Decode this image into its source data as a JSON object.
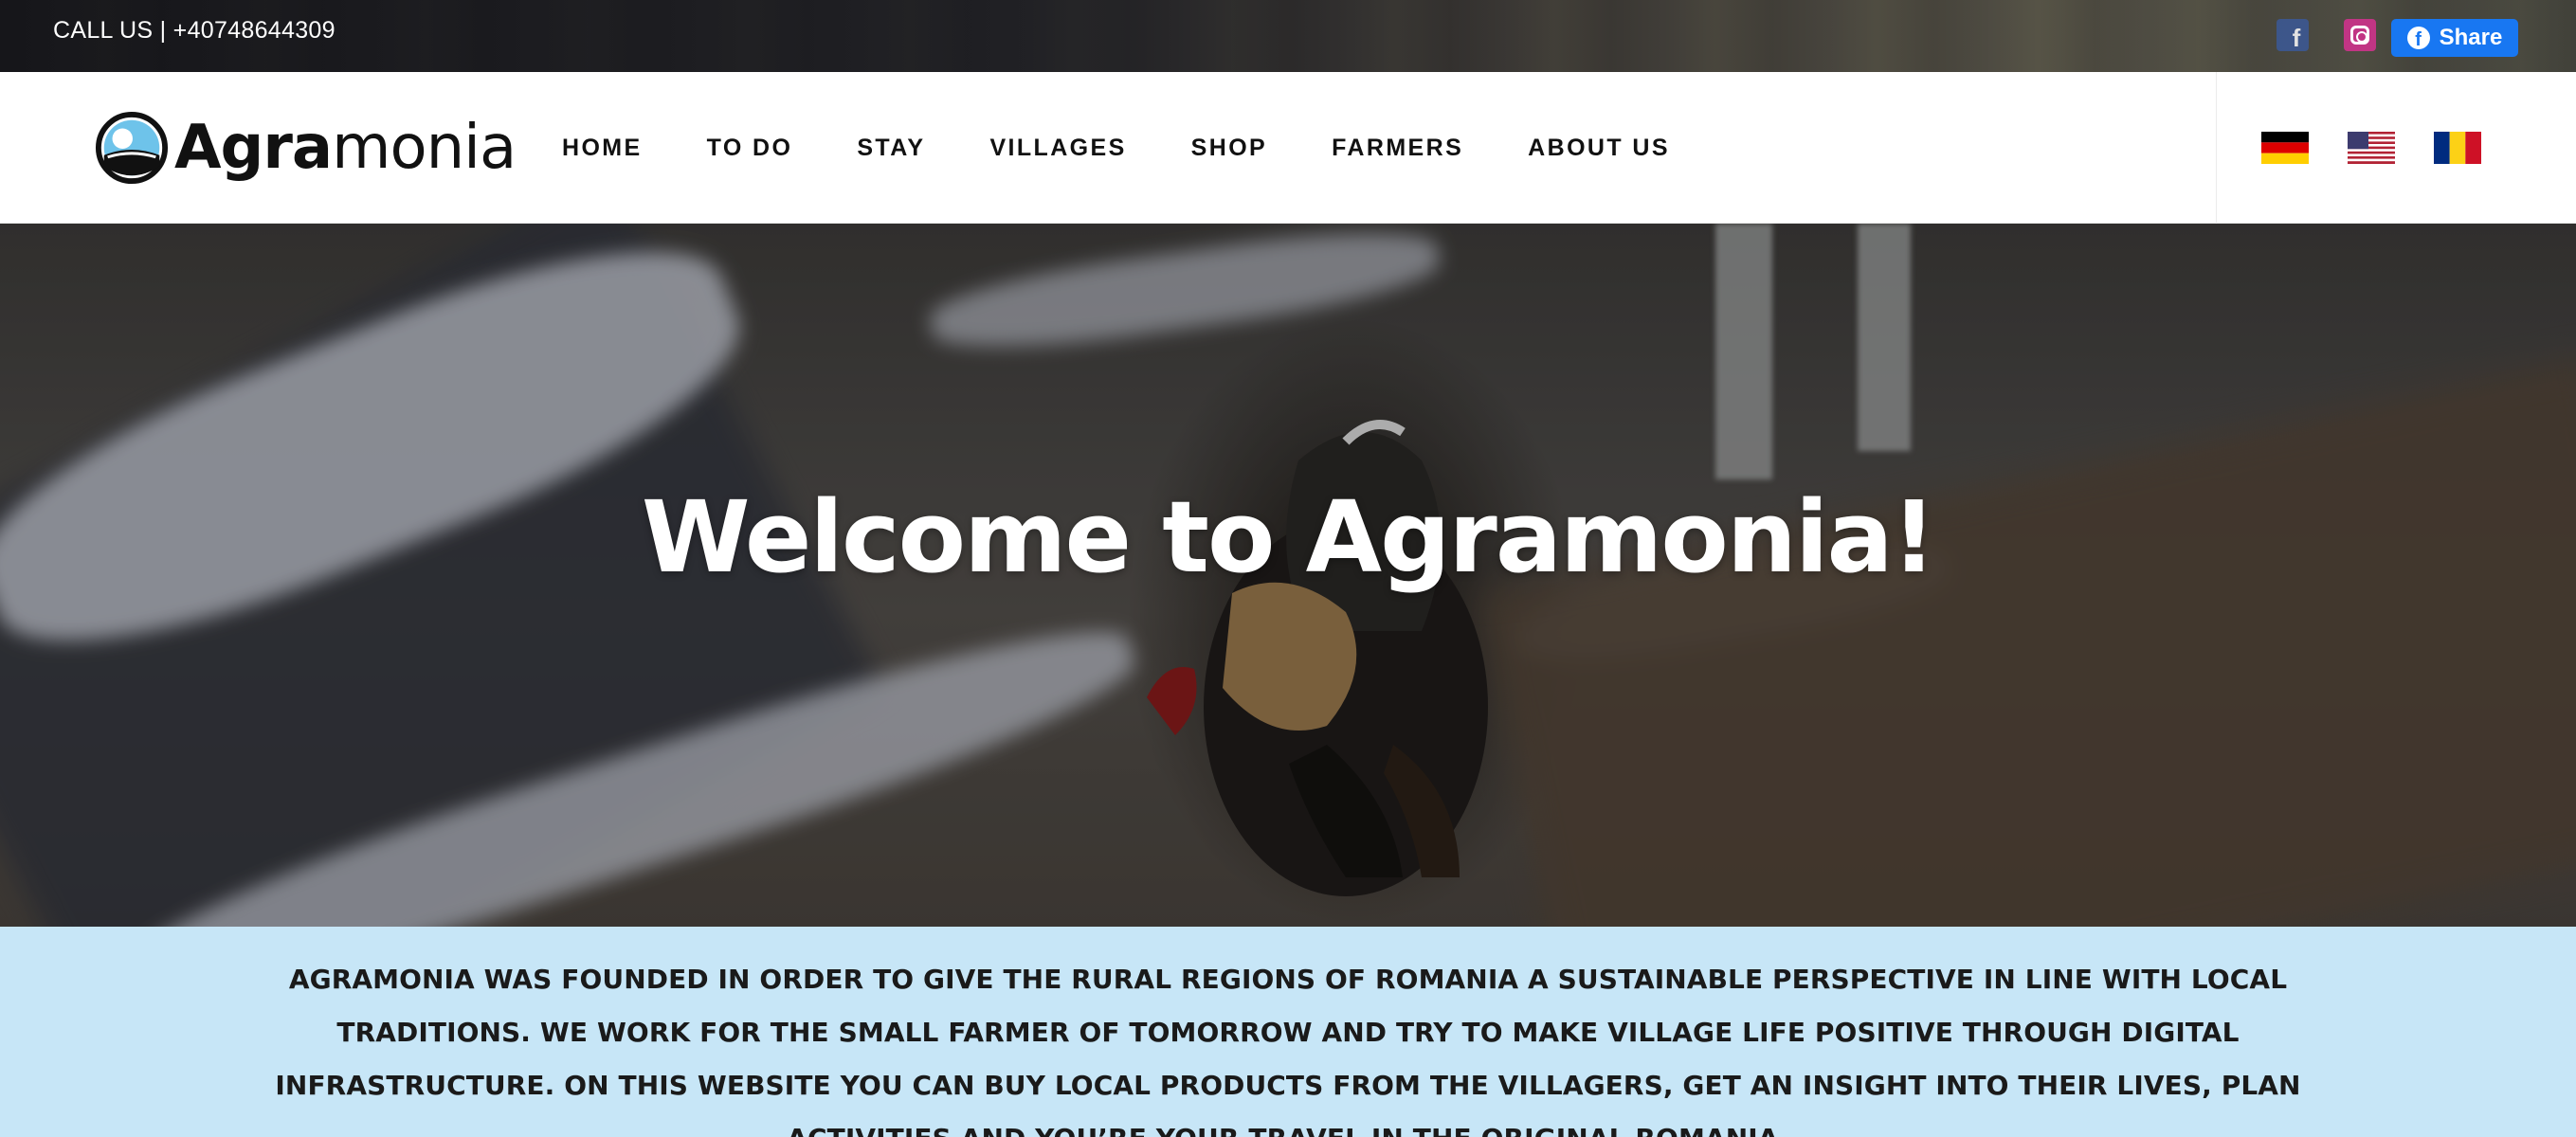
{
  "topbar": {
    "call_text": "CALL US | +40748644309",
    "social": [
      {
        "icon": "facebook-icon",
        "color": "#3b5998"
      },
      {
        "icon": "instagram-icon",
        "color": "#c13584"
      }
    ],
    "share_label": "Share",
    "share_color": "#1877f2"
  },
  "logo": {
    "bold": "Agra",
    "light": "monia"
  },
  "nav": {
    "items": [
      {
        "label": "HOME"
      },
      {
        "label": "TO DO"
      },
      {
        "label": "STAY"
      },
      {
        "label": "VILLAGES"
      },
      {
        "label": "SHOP"
      },
      {
        "label": "FARMERS"
      },
      {
        "label": "ABOUT US"
      }
    ]
  },
  "languages": [
    {
      "icon": "germany-flag-icon"
    },
    {
      "icon": "usa-flag-icon"
    },
    {
      "icon": "romania-flag-icon"
    }
  ],
  "hero": {
    "title": "Welcome to Agramonia!"
  },
  "mission": {
    "text": "AGRAMONIA WAS FOUNDED IN ORDER TO GIVE THE RURAL REGIONS OF ROMANIA A SUSTAINABLE PERSPECTIVE IN LINE WITH LOCAL TRADITIONS. WE WORK FOR THE SMALL FARMER OF TOMORROW AND TRY TO MAKE VILLAGE LIFE POSITIVE THROUGH DIGITAL INFRASTRUCTURE. ON THIS WEBSITE YOU CAN BUY LOCAL PRODUCTS FROM THE VILLAGERS, GET AN INSIGHT INTO THEIR LIVES, PLAN ACTIVITIES AND YOU’RE YOUR TRAVEL IN THE ORIGINAL ROMANIA.",
    "background": "#c7e6f7"
  }
}
